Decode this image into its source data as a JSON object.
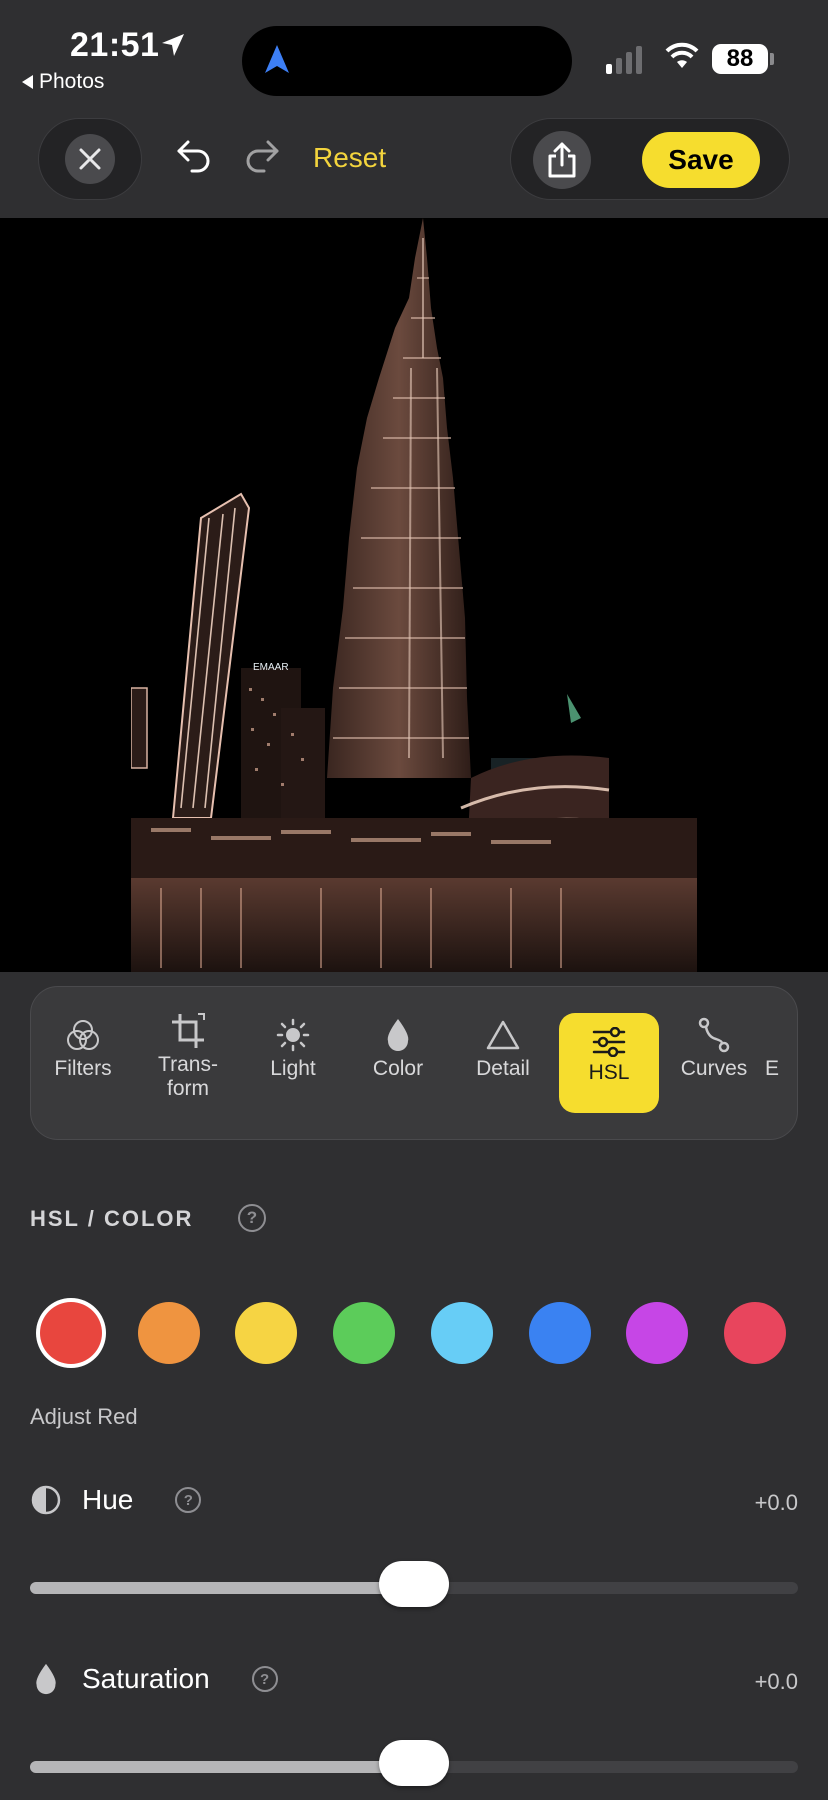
{
  "status_bar": {
    "time": "21:51",
    "back_label": "Photos",
    "battery": "88"
  },
  "toolbar": {
    "reset_label": "Reset",
    "save_label": "Save"
  },
  "tabs": [
    {
      "label": "Filters",
      "icon": "filters-icon",
      "active": false
    },
    {
      "label": "Trans-\nform",
      "icon": "crop-icon",
      "active": false
    },
    {
      "label": "Light",
      "icon": "sun-icon",
      "active": false
    },
    {
      "label": "Color",
      "icon": "drop-icon",
      "active": false
    },
    {
      "label": "Detail",
      "icon": "triangle-icon",
      "active": false
    },
    {
      "label": "HSL",
      "icon": "sliders-icon",
      "active": true
    },
    {
      "label": "Curves",
      "icon": "curves-icon",
      "active": false
    },
    {
      "label": "E",
      "icon": "",
      "active": false
    }
  ],
  "hsl": {
    "section_title": "HSL / COLOR",
    "help": "?",
    "swatch_colors": [
      "#e8463e",
      "#ef9440",
      "#f6d443",
      "#5ccc5a",
      "#67cdf6",
      "#3a82f2",
      "#c646e6",
      "#e8455d"
    ],
    "selected_index": 0,
    "adjust_label": "Adjust Red",
    "hue": {
      "label": "Hue",
      "value": "+0.0",
      "level": 0.5
    },
    "saturation": {
      "label": "Saturation",
      "value": "+0.0",
      "level": 0.5
    }
  },
  "colors": {
    "accent": "#f6dd2e",
    "reset": "#f3d43d",
    "background": "#2f2f31"
  }
}
